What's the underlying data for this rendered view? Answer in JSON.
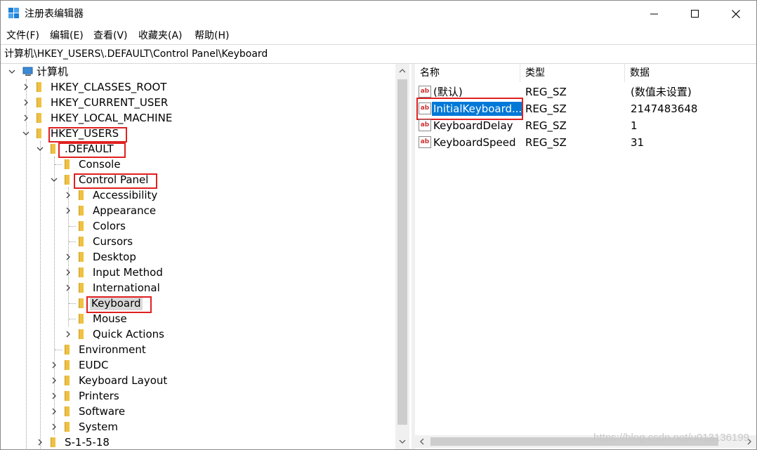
{
  "window": {
    "title": "注册表编辑器",
    "controls": {
      "minimize": "minimize",
      "maximize": "maximize",
      "close": "close"
    }
  },
  "menu": [
    "文件(F)",
    "编辑(E)",
    "查看(V)",
    "收藏夹(A)",
    "帮助(H)"
  ],
  "address": "计算机\\HKEY_USERS\\.DEFAULT\\Control Panel\\Keyboard",
  "tree": {
    "root": "计算机",
    "hives": [
      "HKEY_CLASSES_ROOT",
      "HKEY_CURRENT_USER",
      "HKEY_LOCAL_MACHINE",
      "HKEY_USERS"
    ],
    "default_key": ".DEFAULT",
    "default_children_top": [
      "Console",
      "Control Panel"
    ],
    "control_panel_children": [
      "Accessibility",
      "Appearance",
      "Colors",
      "Cursors",
      "Desktop",
      "Input Method",
      "International",
      "Keyboard",
      "Mouse",
      "Quick Actions"
    ],
    "default_children_rest": [
      "Environment",
      "EUDC",
      "Keyboard Layout",
      "Printers",
      "Software",
      "System"
    ],
    "next_user": "S-1-5-18",
    "selected": "Keyboard"
  },
  "list": {
    "headers": {
      "name": "名称",
      "type": "类型",
      "data": "数据"
    },
    "rows": [
      {
        "name": "(默认)",
        "type": "REG_SZ",
        "data": "(数值未设置)"
      },
      {
        "name": "InitialKeyboard...",
        "type": "REG_SZ",
        "data": "2147483648"
      },
      {
        "name": "KeyboardDelay",
        "type": "REG_SZ",
        "data": "1"
      },
      {
        "name": "KeyboardSpeed",
        "type": "REG_SZ",
        "data": "31"
      }
    ],
    "selected_row": 1
  },
  "watermark": "https://blog.csdn.net/u013136199",
  "colors": {
    "highlight_box": "#e02020",
    "selection": "#0078d7",
    "folder": "#f0c040"
  }
}
